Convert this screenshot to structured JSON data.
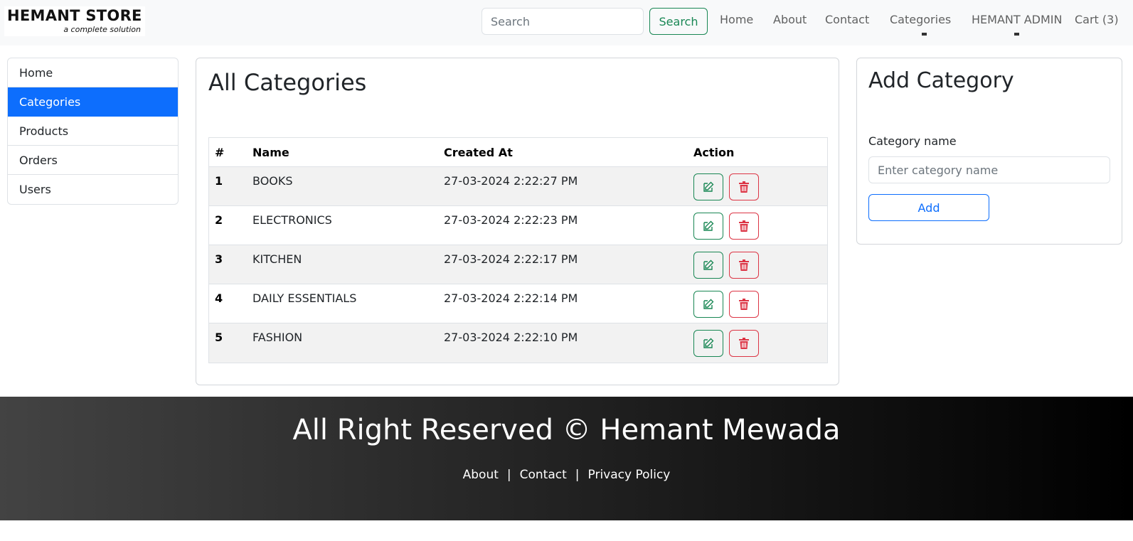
{
  "brand": {
    "name": "HEMANT STORE",
    "tagline": "a complete solution"
  },
  "header": {
    "search": {
      "placeholder": "Search",
      "value": "",
      "button_label": "Search"
    },
    "nav": {
      "home": "Home",
      "about": "About",
      "contact": "Contact",
      "categories": "Categories",
      "user": "HEMANT ADMIN",
      "cart": "Cart (3)"
    }
  },
  "sidebar": {
    "items": [
      {
        "label": "Home",
        "active": false
      },
      {
        "label": "Categories",
        "active": true
      },
      {
        "label": "Products",
        "active": false
      },
      {
        "label": "Orders",
        "active": false
      },
      {
        "label": "Users",
        "active": false
      }
    ]
  },
  "main": {
    "title": "All Categories",
    "table": {
      "columns": [
        "#",
        "Name",
        "Created At",
        "Action"
      ],
      "rows": [
        {
          "num": "1",
          "name": "BOOKS",
          "created": "27-03-2024 2:22:27 PM"
        },
        {
          "num": "2",
          "name": "ELECTRONICS",
          "created": "27-03-2024 2:22:23 PM"
        },
        {
          "num": "3",
          "name": "KITCHEN",
          "created": "27-03-2024 2:22:17 PM"
        },
        {
          "num": "4",
          "name": "DAILY ESSENTIALS",
          "created": "27-03-2024 2:22:14 PM"
        },
        {
          "num": "5",
          "name": "FASHION",
          "created": "27-03-2024 2:22:10 PM"
        }
      ],
      "action_icons": [
        "edit-icon",
        "trash-icon"
      ]
    }
  },
  "add_category": {
    "title": "Add Category",
    "label": "Category name",
    "placeholder": "Enter category name",
    "value": "",
    "button_label": "Add"
  },
  "footer": {
    "text": "All Right Reserved © Hemant Mewada",
    "links": [
      "About",
      "Contact",
      "Privacy Policy"
    ],
    "separator": "|"
  },
  "colors": {
    "primary": "#0d6efd",
    "success": "#198754",
    "danger": "#dc3545",
    "navbar_bg": "#f8f9fa",
    "footer_gradient": [
      "#434343",
      "#000000"
    ]
  }
}
